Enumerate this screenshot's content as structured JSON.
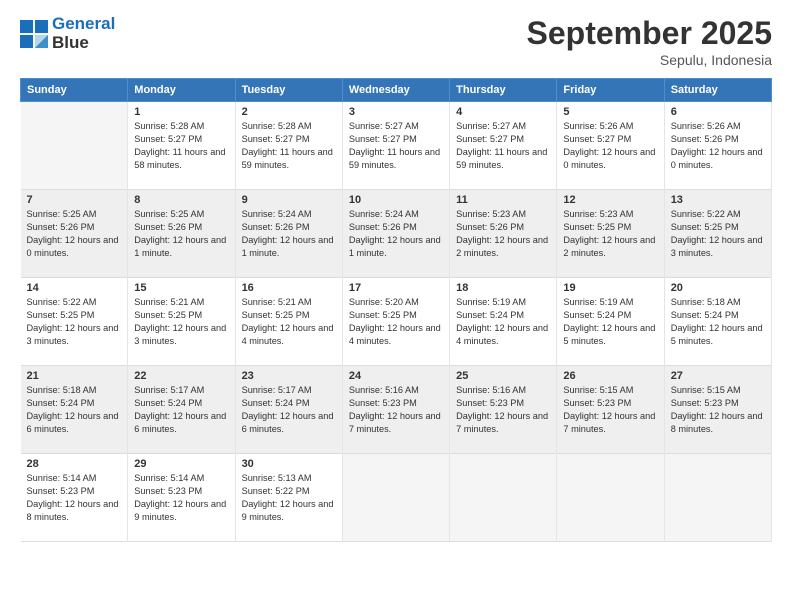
{
  "header": {
    "logo_line1": "General",
    "logo_line2": "Blue",
    "title": "September 2025",
    "location": "Sepulu, Indonesia"
  },
  "days_of_week": [
    "Sunday",
    "Monday",
    "Tuesday",
    "Wednesday",
    "Thursday",
    "Friday",
    "Saturday"
  ],
  "weeks": [
    [
      {
        "day": "",
        "sunrise": "",
        "sunset": "",
        "daylight": ""
      },
      {
        "day": "1",
        "sunrise": "Sunrise: 5:28 AM",
        "sunset": "Sunset: 5:27 PM",
        "daylight": "Daylight: 11 hours and 58 minutes."
      },
      {
        "day": "2",
        "sunrise": "Sunrise: 5:28 AM",
        "sunset": "Sunset: 5:27 PM",
        "daylight": "Daylight: 11 hours and 59 minutes."
      },
      {
        "day": "3",
        "sunrise": "Sunrise: 5:27 AM",
        "sunset": "Sunset: 5:27 PM",
        "daylight": "Daylight: 11 hours and 59 minutes."
      },
      {
        "day": "4",
        "sunrise": "Sunrise: 5:27 AM",
        "sunset": "Sunset: 5:27 PM",
        "daylight": "Daylight: 11 hours and 59 minutes."
      },
      {
        "day": "5",
        "sunrise": "Sunrise: 5:26 AM",
        "sunset": "Sunset: 5:27 PM",
        "daylight": "Daylight: 12 hours and 0 minutes."
      },
      {
        "day": "6",
        "sunrise": "Sunrise: 5:26 AM",
        "sunset": "Sunset: 5:26 PM",
        "daylight": "Daylight: 12 hours and 0 minutes."
      }
    ],
    [
      {
        "day": "7",
        "sunrise": "Sunrise: 5:25 AM",
        "sunset": "Sunset: 5:26 PM",
        "daylight": "Daylight: 12 hours and 0 minutes."
      },
      {
        "day": "8",
        "sunrise": "Sunrise: 5:25 AM",
        "sunset": "Sunset: 5:26 PM",
        "daylight": "Daylight: 12 hours and 1 minute."
      },
      {
        "day": "9",
        "sunrise": "Sunrise: 5:24 AM",
        "sunset": "Sunset: 5:26 PM",
        "daylight": "Daylight: 12 hours and 1 minute."
      },
      {
        "day": "10",
        "sunrise": "Sunrise: 5:24 AM",
        "sunset": "Sunset: 5:26 PM",
        "daylight": "Daylight: 12 hours and 1 minute."
      },
      {
        "day": "11",
        "sunrise": "Sunrise: 5:23 AM",
        "sunset": "Sunset: 5:26 PM",
        "daylight": "Daylight: 12 hours and 2 minutes."
      },
      {
        "day": "12",
        "sunrise": "Sunrise: 5:23 AM",
        "sunset": "Sunset: 5:25 PM",
        "daylight": "Daylight: 12 hours and 2 minutes."
      },
      {
        "day": "13",
        "sunrise": "Sunrise: 5:22 AM",
        "sunset": "Sunset: 5:25 PM",
        "daylight": "Daylight: 12 hours and 3 minutes."
      }
    ],
    [
      {
        "day": "14",
        "sunrise": "Sunrise: 5:22 AM",
        "sunset": "Sunset: 5:25 PM",
        "daylight": "Daylight: 12 hours and 3 minutes."
      },
      {
        "day": "15",
        "sunrise": "Sunrise: 5:21 AM",
        "sunset": "Sunset: 5:25 PM",
        "daylight": "Daylight: 12 hours and 3 minutes."
      },
      {
        "day": "16",
        "sunrise": "Sunrise: 5:21 AM",
        "sunset": "Sunset: 5:25 PM",
        "daylight": "Daylight: 12 hours and 4 minutes."
      },
      {
        "day": "17",
        "sunrise": "Sunrise: 5:20 AM",
        "sunset": "Sunset: 5:25 PM",
        "daylight": "Daylight: 12 hours and 4 minutes."
      },
      {
        "day": "18",
        "sunrise": "Sunrise: 5:19 AM",
        "sunset": "Sunset: 5:24 PM",
        "daylight": "Daylight: 12 hours and 4 minutes."
      },
      {
        "day": "19",
        "sunrise": "Sunrise: 5:19 AM",
        "sunset": "Sunset: 5:24 PM",
        "daylight": "Daylight: 12 hours and 5 minutes."
      },
      {
        "day": "20",
        "sunrise": "Sunrise: 5:18 AM",
        "sunset": "Sunset: 5:24 PM",
        "daylight": "Daylight: 12 hours and 5 minutes."
      }
    ],
    [
      {
        "day": "21",
        "sunrise": "Sunrise: 5:18 AM",
        "sunset": "Sunset: 5:24 PM",
        "daylight": "Daylight: 12 hours and 6 minutes."
      },
      {
        "day": "22",
        "sunrise": "Sunrise: 5:17 AM",
        "sunset": "Sunset: 5:24 PM",
        "daylight": "Daylight: 12 hours and 6 minutes."
      },
      {
        "day": "23",
        "sunrise": "Sunrise: 5:17 AM",
        "sunset": "Sunset: 5:24 PM",
        "daylight": "Daylight: 12 hours and 6 minutes."
      },
      {
        "day": "24",
        "sunrise": "Sunrise: 5:16 AM",
        "sunset": "Sunset: 5:23 PM",
        "daylight": "Daylight: 12 hours and 7 minutes."
      },
      {
        "day": "25",
        "sunrise": "Sunrise: 5:16 AM",
        "sunset": "Sunset: 5:23 PM",
        "daylight": "Daylight: 12 hours and 7 minutes."
      },
      {
        "day": "26",
        "sunrise": "Sunrise: 5:15 AM",
        "sunset": "Sunset: 5:23 PM",
        "daylight": "Daylight: 12 hours and 7 minutes."
      },
      {
        "day": "27",
        "sunrise": "Sunrise: 5:15 AM",
        "sunset": "Sunset: 5:23 PM",
        "daylight": "Daylight: 12 hours and 8 minutes."
      }
    ],
    [
      {
        "day": "28",
        "sunrise": "Sunrise: 5:14 AM",
        "sunset": "Sunset: 5:23 PM",
        "daylight": "Daylight: 12 hours and 8 minutes."
      },
      {
        "day": "29",
        "sunrise": "Sunrise: 5:14 AM",
        "sunset": "Sunset: 5:23 PM",
        "daylight": "Daylight: 12 hours and 9 minutes."
      },
      {
        "day": "30",
        "sunrise": "Sunrise: 5:13 AM",
        "sunset": "Sunset: 5:22 PM",
        "daylight": "Daylight: 12 hours and 9 minutes."
      },
      {
        "day": "",
        "sunrise": "",
        "sunset": "",
        "daylight": ""
      },
      {
        "day": "",
        "sunrise": "",
        "sunset": "",
        "daylight": ""
      },
      {
        "day": "",
        "sunrise": "",
        "sunset": "",
        "daylight": ""
      },
      {
        "day": "",
        "sunrise": "",
        "sunset": "",
        "daylight": ""
      }
    ]
  ]
}
